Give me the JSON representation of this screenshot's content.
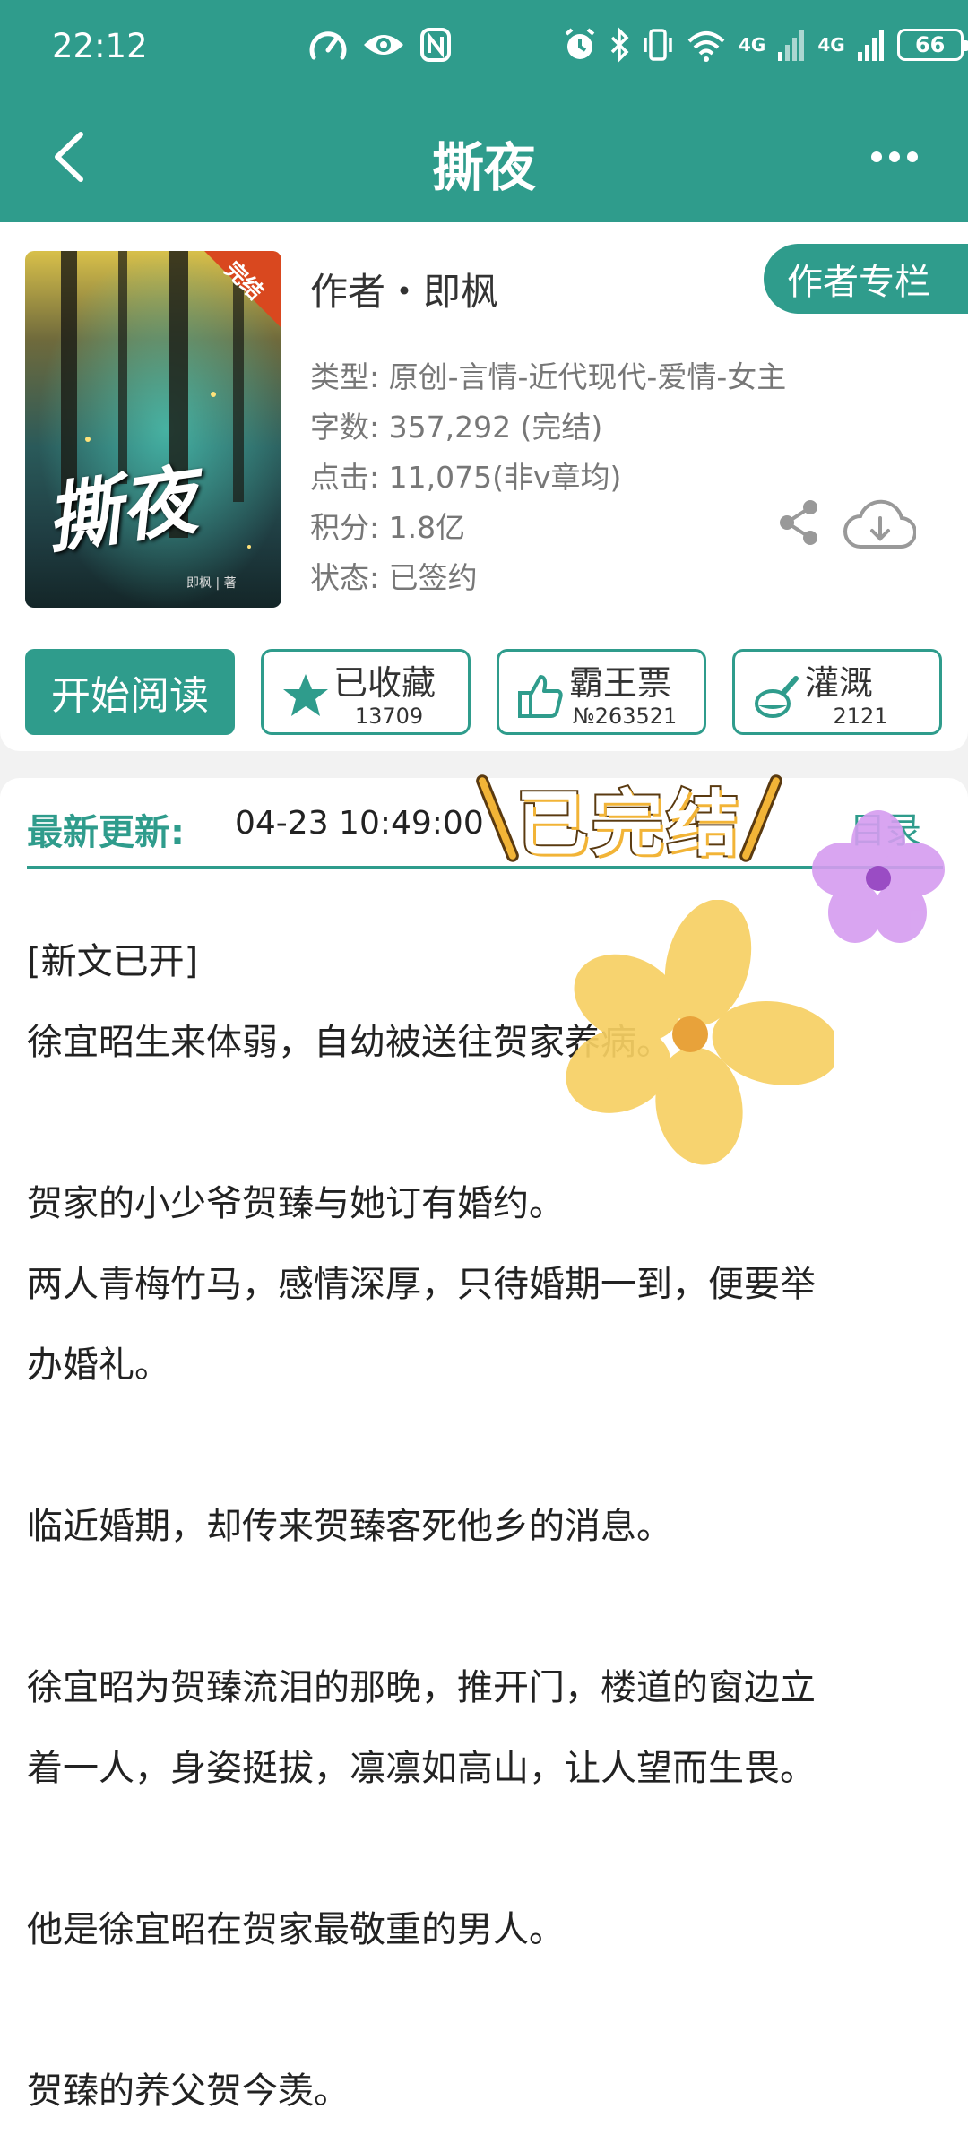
{
  "status_bar": {
    "time": "22:12",
    "net1": "4G",
    "net2": "4G",
    "battery": "66"
  },
  "header": {
    "title": "撕夜"
  },
  "book": {
    "cover_badge": "完结",
    "cover_title": "撕夜",
    "cover_author": "即枫 | 著",
    "author": "作者・即枫",
    "author_column_button": "作者专栏",
    "type": "类型: 原创-言情-近代现代-爱情-女主",
    "words": "字数: 357,292 (完结)",
    "clicks": "点击: 11,075(非v章均)",
    "score": "积分: 1.8亿",
    "state": "状态: 已签约"
  },
  "actions": {
    "read": "开始阅读",
    "collect": {
      "label": "已收藏",
      "count": "13709"
    },
    "vote": {
      "label": "霸王票",
      "count": "№263521"
    },
    "water": {
      "label": "灌溉",
      "count": "2121"
    }
  },
  "update": {
    "label": "最新更新:",
    "time": "04-23 10:49:00",
    "toc": "目录",
    "stamp": "已完结"
  },
  "description": [
    "[新文已开]",
    "徐宜昭生来体弱，自幼被送往贺家养病。",
    "贺家的小少爷贺臻与她订有婚约。",
    "两人青梅竹马，感情深厚，只待婚期一到，便要举",
    "办婚礼。",
    "临近婚期，却传来贺臻客死他乡的消息。",
    "徐宜昭为贺臻流泪的那晚，推开门，楼道的窗边立",
    "着一人，身姿挺拔，凛凛如高山，让人望而生畏。",
    "他是徐宜昭在贺家最敬重的男人。",
    "贺臻的养父贺今羡。"
  ],
  "colors": {
    "primary": "#2f9c8c",
    "stamp_yellow": "#f2b437",
    "flower_yellow": "#f7d063",
    "flower_purple": "#d59cf0"
  }
}
